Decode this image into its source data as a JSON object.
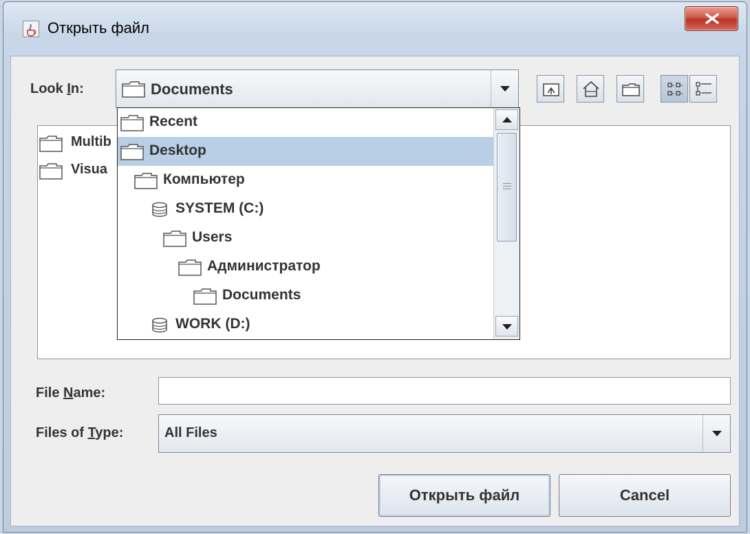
{
  "window": {
    "title": "Открыть файл"
  },
  "look_in": {
    "label_prefix": "Look ",
    "label_mnemonic": "I",
    "label_suffix": "n:",
    "value": "Documents"
  },
  "dropdown": {
    "items": [
      {
        "label": "Recent",
        "icon": "folder-icon"
      },
      {
        "label": "Desktop",
        "icon": "folder-icon",
        "selected": true
      },
      {
        "label": "Компьютер",
        "icon": "folder-icon"
      },
      {
        "label": "SYSTEM (C:)",
        "icon": "drive-icon"
      },
      {
        "label": "Users",
        "icon": "folder-icon"
      },
      {
        "label": "Администратор",
        "icon": "folder-icon"
      },
      {
        "label": "Documents",
        "icon": "folder-icon"
      },
      {
        "label": "WORK (D:)",
        "icon": "drive-icon"
      }
    ]
  },
  "files": [
    {
      "name": "Multib"
    },
    {
      "name": "Visua"
    }
  ],
  "file_name": {
    "label_prefix": "File ",
    "label_mnemonic": "N",
    "label_suffix": "ame:",
    "value": ""
  },
  "file_type": {
    "label_prefix": "Files of ",
    "label_mnemonic": "T",
    "label_suffix": "ype:",
    "value": "All Files"
  },
  "buttons": {
    "open": "Открыть файл",
    "cancel": "Cancel"
  }
}
